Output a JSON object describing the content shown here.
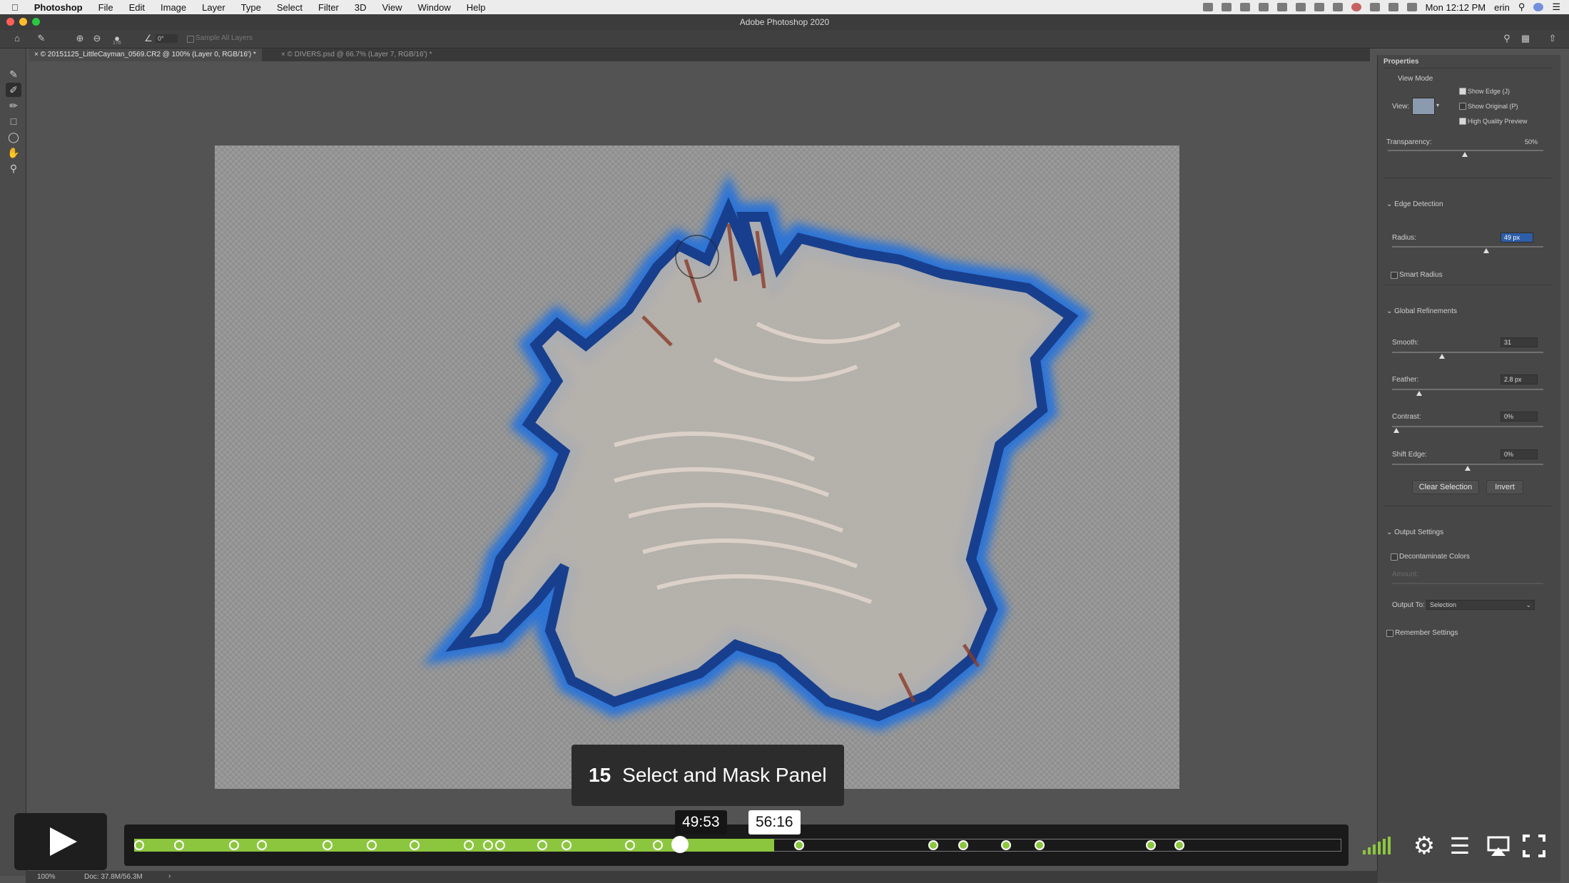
{
  "menubar": {
    "app": "Photoshop",
    "items": [
      "File",
      "Edit",
      "Image",
      "Layer",
      "Type",
      "Select",
      "Filter",
      "3D",
      "View",
      "Window",
      "Help"
    ],
    "clock": "Mon 12:12 PM",
    "user": "erin"
  },
  "window": {
    "title": "Adobe Photoshop 2020"
  },
  "options": {
    "size": "176",
    "angle": "0°",
    "sample_all": "Sample All Layers"
  },
  "tabs": [
    {
      "label": "© 20151125_LittleCayman_0569.CR2 @ 100% (Layer 0, RGB/16') *"
    },
    {
      "label": "© DIVERS.psd @ 66.7% (Layer 7, RGB/16') *"
    }
  ],
  "properties": {
    "title": "Properties",
    "view_mode": "View Mode",
    "view_label": "View:",
    "show_edge": "Show Edge (J)",
    "show_original": "Show Original (P)",
    "high_quality": "High Quality Preview",
    "transparency_label": "Transparency:",
    "transparency_value": "50%",
    "edge_detection": "Edge Detection",
    "radius_label": "Radius:",
    "radius_value": "49 px",
    "smart_radius": "Smart Radius",
    "global_refinements": "Global Refinements",
    "smooth_label": "Smooth:",
    "smooth_value": "31",
    "feather_label": "Feather:",
    "feather_value": "2.8 px",
    "contrast_label": "Contrast:",
    "contrast_value": "0%",
    "shift_label": "Shift Edge:",
    "shift_value": "0%",
    "clear_selection": "Clear Selection",
    "invert": "Invert",
    "output_settings": "Output Settings",
    "decontaminate": "Decontaminate Colors",
    "amount_label": "Amount:",
    "output_to_label": "Output To:",
    "output_to_value": "Selection",
    "remember": "Remember Settings"
  },
  "status": {
    "zoom": "100%",
    "doc": "Doc: 37.8M/56.3M"
  },
  "video": {
    "chapter_number": "15",
    "chapter_title": "Select and Mask Panel",
    "hover_time": "49:53",
    "chapter_time": "56:16",
    "played_fraction": 0.53,
    "marker_fractions": [
      0.004,
      0.037,
      0.083,
      0.106,
      0.16,
      0.197,
      0.232,
      0.277,
      0.293,
      0.303,
      0.338,
      0.358,
      0.411,
      0.434,
      0.551,
      0.662,
      0.687,
      0.722,
      0.75,
      0.842,
      0.866
    ]
  },
  "colors": {
    "progress": "#8cc63f",
    "chapter_bg": "#2c2c2c"
  }
}
